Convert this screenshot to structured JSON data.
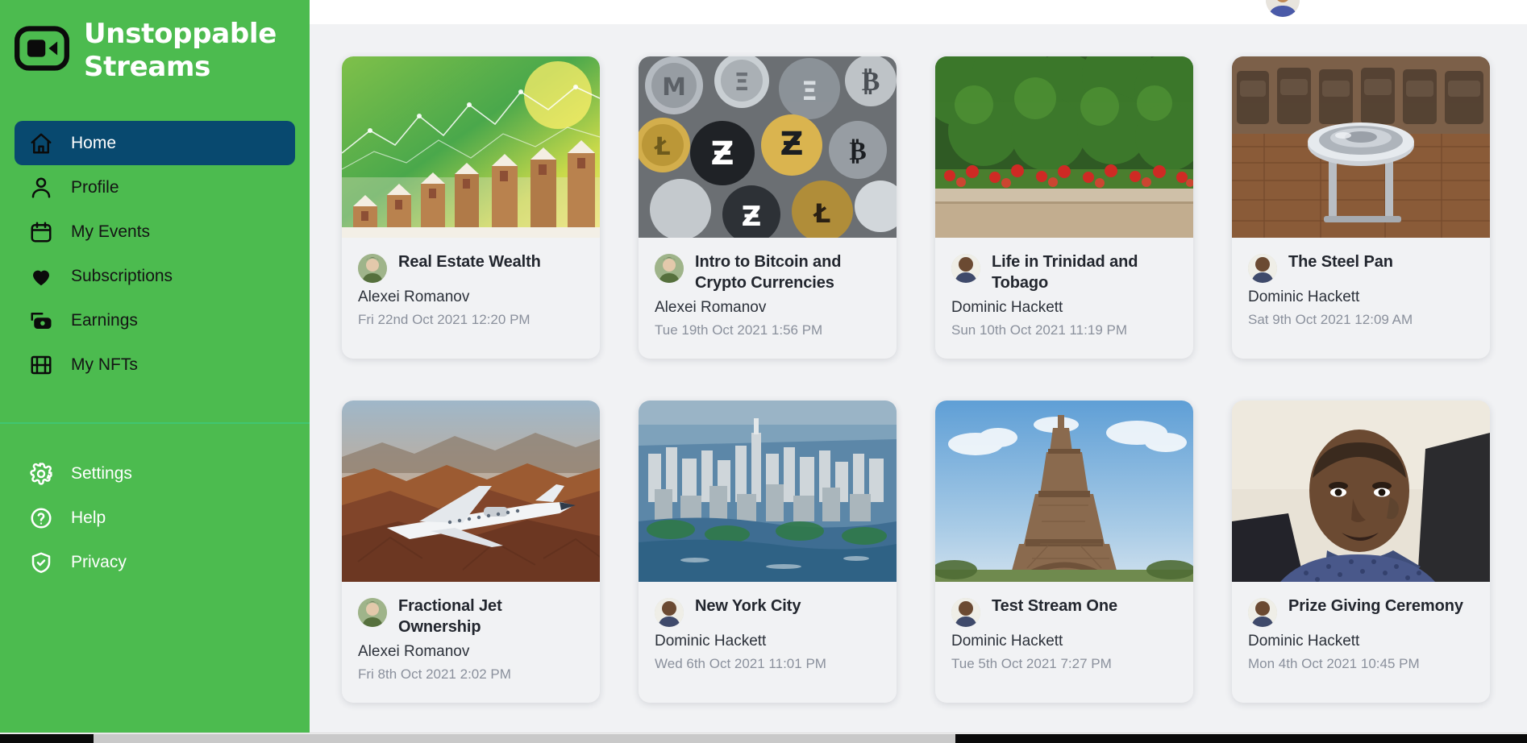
{
  "brand": {
    "name_line1": "Unstoppable",
    "name_line2": "Streams",
    "logo_icon": "video-camera-icon",
    "green": "#4cbb4f",
    "active_blue": "#08496f"
  },
  "sidebar": {
    "primary_items": [
      {
        "label": "Home",
        "icon": "home-icon",
        "active": true
      },
      {
        "label": "Profile",
        "icon": "person-icon",
        "active": false
      },
      {
        "label": "My Events",
        "icon": "calendar-icon",
        "active": false
      },
      {
        "label": "Subscriptions",
        "icon": "heart-icon",
        "active": false
      },
      {
        "label": "Earnings",
        "icon": "money-camera-icon",
        "active": false
      },
      {
        "label": "My NFTs",
        "icon": "film-icon",
        "active": false
      }
    ],
    "secondary_items": [
      {
        "label": "Settings",
        "icon": "gear-icon"
      },
      {
        "label": "Help",
        "icon": "question-circle-icon"
      },
      {
        "label": "Privacy",
        "icon": "shield-check-icon"
      }
    ]
  },
  "topbar": {
    "avatar_icon": "user-avatar"
  },
  "cards": [
    {
      "title": "Real Estate Wealth",
      "author": "Alexei Romanov",
      "date": "Fri 22nd Oct 2021 12:20 PM",
      "thumb": "real-estate-coins-chart",
      "avatar": "alexei-avatar"
    },
    {
      "title": "Intro to Bitcoin and Crypto Currencies",
      "author": "Alexei Romanov",
      "date": "Tue 19th Oct 2021 1:56 PM",
      "thumb": "crypto-coins",
      "avatar": "alexei-avatar"
    },
    {
      "title": "Life in Trinidad and Tobago",
      "author": "Dominic Hackett",
      "date": "Sun 10th Oct 2021 11:19 PM",
      "thumb": "red-flowers-hedge",
      "avatar": "dominic-avatar"
    },
    {
      "title": "The Steel Pan",
      "author": "Dominic Hackett",
      "date": "Sat 9th Oct 2021 12:09 AM",
      "thumb": "steel-pan-drum",
      "avatar": "dominic-avatar"
    },
    {
      "title": "Fractional Jet Ownership",
      "author": "Alexei Romanov",
      "date": "Fri 8th Oct 2021 2:02 PM",
      "thumb": "private-jet-canyon",
      "avatar": "alexei-avatar"
    },
    {
      "title": "New York City",
      "author": "Dominic Hackett",
      "date": "Wed 6th Oct 2021 11:01 PM",
      "thumb": "manhattan-skyline",
      "avatar": "dominic-avatar"
    },
    {
      "title": "Test Stream One",
      "author": "Dominic Hackett",
      "date": "Tue 5th Oct 2021 7:27 PM",
      "thumb": "eiffel-tower",
      "avatar": "dominic-avatar"
    },
    {
      "title": "Prize Giving Ceremony",
      "author": "Dominic Hackett",
      "date": "Mon 4th Oct 2021 10:45 PM",
      "thumb": "man-portrait",
      "avatar": "dominic-avatar"
    }
  ]
}
